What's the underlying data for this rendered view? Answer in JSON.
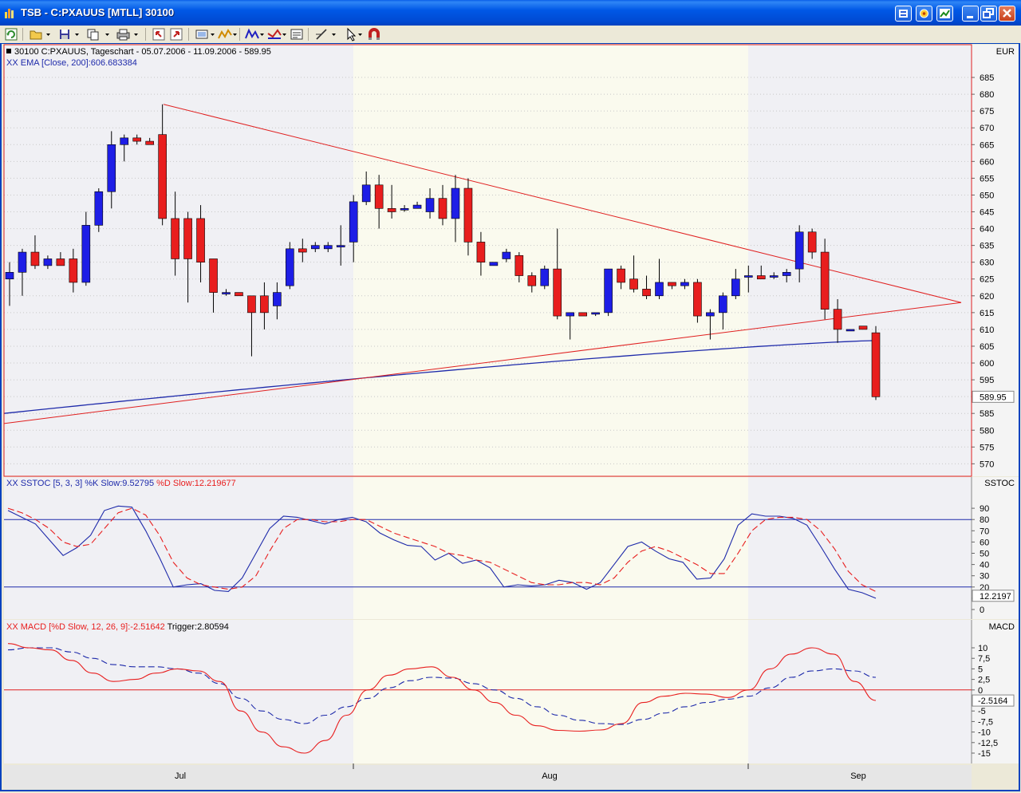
{
  "window": {
    "title": "TSB - C:PXAUUS [MTLL] 30100",
    "buttons": [
      "minimize",
      "restore",
      "close"
    ]
  },
  "toolbar": {
    "icons": [
      "refresh-icon",
      "open-folder-icon",
      "save-icon",
      "copy-icon",
      "print-icon",
      "undo-icon",
      "redo-icon",
      "chart-type-icon",
      "indicator-icon",
      "drawing-icon",
      "color-icon",
      "properties-icon",
      "line-tool-icon",
      "pointer-icon",
      "magnet-icon"
    ]
  },
  "colors": {
    "up_candle": "#1E1EE6",
    "down_candle": "#E81E1E",
    "ema": "#1E2AAA",
    "trendline": "#E02020",
    "pane_bg": "#F0F0F4",
    "highlight_bg": "#FAFAEE"
  },
  "panes": {
    "price": {
      "header": "30100  C:PXAUUS, Tageschart - 05.07.2006 - 11.09.2006 - 589.95",
      "ema_label": "XX EMA [Close, 200]:606.683384",
      "axis_title": "EUR",
      "ticks": [
        570,
        575,
        580,
        585,
        590,
        595,
        600,
        605,
        610,
        615,
        620,
        625,
        630,
        635,
        640,
        645,
        650,
        655,
        660,
        665,
        670,
        675,
        680,
        685
      ],
      "tick_labels": [
        "570",
        "575",
        "580",
        "585",
        "595",
        "600",
        "605",
        "610",
        "615",
        "620",
        "625",
        "630",
        "635",
        "640",
        "645",
        "650",
        "655",
        "660",
        "665",
        "670",
        "675",
        "680",
        "685"
      ],
      "last_value": "589.95"
    },
    "sstoc": {
      "label": "XX SSTOC [5, 3, 3] %K Slow:9.52795 %D Slow:12.219677",
      "label_k": "XX SSTOC [5, 3, 3] %K Slow:9.52795",
      "label_d": " %D Slow:12.219677",
      "axis_title": "SSTOC",
      "tick_labels": [
        "90",
        "80",
        "70",
        "60",
        "50",
        "40",
        "30",
        "20",
        "10",
        "0"
      ],
      "last_value": "12.2197",
      "bands": [
        80,
        20
      ]
    },
    "macd": {
      "label": "XX MACD [%D Slow, 12, 26, 9]:-2.51642 Trigger:2.80594",
      "label_main": "XX MACD [%D Slow, 12, 26, 9]:-2.51642",
      "label_trigger": " Trigger:2.80594",
      "axis_title": "MACD",
      "tick_labels": [
        "10",
        "7,5",
        "5",
        "2,5",
        "0",
        "-5",
        "-7,5",
        "-10",
        "-12,5",
        "-15"
      ],
      "last_value": "-2.5164"
    },
    "xaxis": {
      "month_labels": [
        "Jul",
        "Aug",
        "Sep"
      ]
    }
  },
  "chart_data": {
    "type": "candlestick",
    "title": "30100  C:PXAUUS, Tageschart - 05.07.2006 - 11.09.2006 - 589.95",
    "candles": [
      {
        "o": 625,
        "h": 630,
        "l": 617,
        "c": 627
      },
      {
        "o": 627,
        "h": 634,
        "l": 620,
        "c": 633
      },
      {
        "o": 633,
        "h": 638,
        "l": 628,
        "c": 629
      },
      {
        "o": 629,
        "h": 632,
        "l": 628,
        "c": 631
      },
      {
        "o": 631,
        "h": 633,
        "l": 629,
        "c": 629
      },
      {
        "o": 631,
        "h": 634,
        "l": 621,
        "c": 624
      },
      {
        "o": 624,
        "h": 645,
        "l": 623,
        "c": 641
      },
      {
        "o": 641,
        "h": 652,
        "l": 639,
        "c": 651
      },
      {
        "o": 651,
        "h": 669,
        "l": 646,
        "c": 665
      },
      {
        "o": 665,
        "h": 668,
        "l": 660,
        "c": 667
      },
      {
        "o": 667,
        "h": 668,
        "l": 665,
        "c": 666
      },
      {
        "o": 666,
        "h": 667,
        "l": 665,
        "c": 665
      },
      {
        "o": 668,
        "h": 677,
        "l": 641,
        "c": 643
      },
      {
        "o": 643,
        "h": 651,
        "l": 626,
        "c": 631
      },
      {
        "o": 643,
        "h": 645,
        "l": 618,
        "c": 631
      },
      {
        "o": 643,
        "h": 647,
        "l": 624,
        "c": 630
      },
      {
        "o": 631,
        "h": 631,
        "l": 615,
        "c": 621
      },
      {
        "o": 621,
        "h": 622,
        "l": 620,
        "c": 621
      },
      {
        "o": 621,
        "h": 621,
        "l": 620,
        "c": 620
      },
      {
        "o": 620,
        "h": 620,
        "l": 602,
        "c": 615
      },
      {
        "o": 620,
        "h": 624,
        "l": 610,
        "c": 615
      },
      {
        "o": 617,
        "h": 624,
        "l": 613,
        "c": 621
      },
      {
        "o": 623,
        "h": 636,
        "l": 622,
        "c": 634
      },
      {
        "o": 634,
        "h": 637,
        "l": 630,
        "c": 633
      },
      {
        "o": 634,
        "h": 636,
        "l": 633,
        "c": 635
      },
      {
        "o": 634,
        "h": 636,
        "l": 633,
        "c": 635
      },
      {
        "o": 635,
        "h": 641,
        "l": 629,
        "c": 635
      },
      {
        "o": 636,
        "h": 650,
        "l": 630,
        "c": 648
      },
      {
        "o": 648,
        "h": 657,
        "l": 647,
        "c": 653
      },
      {
        "o": 653,
        "h": 656,
        "l": 640,
        "c": 646
      },
      {
        "o": 646,
        "h": 653,
        "l": 643,
        "c": 645
      },
      {
        "o": 646,
        "h": 647,
        "l": 645,
        "c": 646
      },
      {
        "o": 646,
        "h": 648,
        "l": 646,
        "c": 647
      },
      {
        "o": 645,
        "h": 652,
        "l": 643,
        "c": 649
      },
      {
        "o": 649,
        "h": 653,
        "l": 641,
        "c": 643
      },
      {
        "o": 643,
        "h": 656,
        "l": 636,
        "c": 652
      },
      {
        "o": 652,
        "h": 655,
        "l": 632,
        "c": 636
      },
      {
        "o": 636,
        "h": 639,
        "l": 626,
        "c": 630
      },
      {
        "o": 629,
        "h": 630,
        "l": 629,
        "c": 630
      },
      {
        "o": 631,
        "h": 634,
        "l": 630,
        "c": 633
      },
      {
        "o": 632,
        "h": 633,
        "l": 624,
        "c": 626
      },
      {
        "o": 626,
        "h": 627,
        "l": 621,
        "c": 623
      },
      {
        "o": 623,
        "h": 629,
        "l": 622,
        "c": 628
      },
      {
        "o": 628,
        "h": 640,
        "l": 613,
        "c": 614
      },
      {
        "o": 614,
        "h": 615,
        "l": 607,
        "c": 615
      },
      {
        "o": 615,
        "h": 615,
        "l": 614,
        "c": 614
      },
      {
        "o": 615,
        "h": 615,
        "l": 614,
        "c": 615
      },
      {
        "o": 615,
        "h": 628,
        "l": 614,
        "c": 628
      },
      {
        "o": 628,
        "h": 629,
        "l": 622,
        "c": 624
      },
      {
        "o": 625,
        "h": 632,
        "l": 621,
        "c": 622
      },
      {
        "o": 622,
        "h": 626,
        "l": 619,
        "c": 620
      },
      {
        "o": 620,
        "h": 631,
        "l": 619,
        "c": 624
      },
      {
        "o": 624,
        "h": 624,
        "l": 622,
        "c": 623
      },
      {
        "o": 623,
        "h": 625,
        "l": 622,
        "c": 624
      },
      {
        "o": 624,
        "h": 625,
        "l": 612,
        "c": 614
      },
      {
        "o": 614,
        "h": 616,
        "l": 607,
        "c": 615
      },
      {
        "o": 615,
        "h": 621,
        "l": 610,
        "c": 620
      },
      {
        "o": 620,
        "h": 628,
        "l": 619,
        "c": 625
      },
      {
        "o": 626,
        "h": 629,
        "l": 621,
        "c": 626
      },
      {
        "o": 626,
        "h": 629,
        "l": 625,
        "c": 625
      },
      {
        "o": 626,
        "h": 627,
        "l": 625,
        "c": 626
      },
      {
        "o": 626,
        "h": 628,
        "l": 624,
        "c": 627
      },
      {
        "o": 628,
        "h": 641,
        "l": 624,
        "c": 639
      },
      {
        "o": 639,
        "h": 640,
        "l": 631,
        "c": 633
      },
      {
        "o": 633,
        "h": 637,
        "l": 613,
        "c": 616
      },
      {
        "o": 616,
        "h": 619,
        "l": 606,
        "c": 610
      },
      {
        "o": 610,
        "h": 610,
        "l": 610,
        "c": 610
      },
      {
        "o": 611,
        "h": 611,
        "l": 610,
        "c": 610
      },
      {
        "o": 609,
        "h": 611,
        "l": 589,
        "c": 589.95
      }
    ],
    "ema200_start": 585,
    "ema200_end": 606.683384,
    "sstoc_k": [
      88,
      82,
      76,
      62,
      48,
      55,
      66,
      88,
      92,
      91,
      70,
      46,
      20,
      22,
      23,
      17,
      16,
      28,
      50,
      72,
      83,
      82,
      79,
      76,
      80,
      82,
      78,
      68,
      62,
      57,
      56,
      44,
      50,
      41,
      44,
      37,
      20,
      22,
      21,
      22,
      26,
      24,
      18,
      24,
      40,
      56,
      60,
      52,
      45,
      42,
      27,
      28,
      45,
      75,
      85,
      83,
      83,
      81,
      75,
      56,
      36,
      18,
      15,
      10
    ],
    "sstoc_d": [
      90,
      86,
      80,
      72,
      60,
      56,
      58,
      72,
      86,
      90,
      84,
      66,
      42,
      28,
      22,
      20,
      18,
      20,
      30,
      52,
      72,
      80,
      80,
      78,
      78,
      80,
      80,
      74,
      68,
      64,
      60,
      56,
      50,
      48,
      44,
      42,
      36,
      30,
      24,
      22,
      22,
      24,
      24,
      22,
      28,
      42,
      52,
      56,
      52,
      46,
      40,
      32,
      32,
      50,
      70,
      80,
      82,
      82,
      80,
      70,
      54,
      34,
      22,
      16
    ],
    "macd": [
      11,
      10,
      9.5,
      7,
      4,
      2,
      2.5,
      4,
      5,
      4.5,
      2,
      -5,
      -10,
      -13.5,
      -15,
      -12,
      -6,
      0,
      3.5,
      5,
      5.5,
      3,
      0,
      -3,
      -6,
      -8.5,
      -9.6,
      -9.8,
      -9.5,
      -8,
      -3,
      -1.5,
      -0.8,
      -1,
      -1.8,
      0,
      5,
      8.5,
      10,
      8.5,
      2,
      -2.5
    ],
    "trigger": [
      9.5,
      10,
      10,
      9,
      7.5,
      6,
      5.5,
      5.5,
      5,
      4,
      1.5,
      -2,
      -5,
      -7,
      -8,
      -6,
      -4,
      -2,
      0.5,
      2.2,
      3,
      2.8,
      1.5,
      0,
      -2,
      -4,
      -6,
      -7.2,
      -8,
      -8.2,
      -7,
      -5.5,
      -4,
      -3,
      -2.2,
      -1.5,
      0.5,
      3,
      4.5,
      5,
      4.5,
      3
    ]
  }
}
